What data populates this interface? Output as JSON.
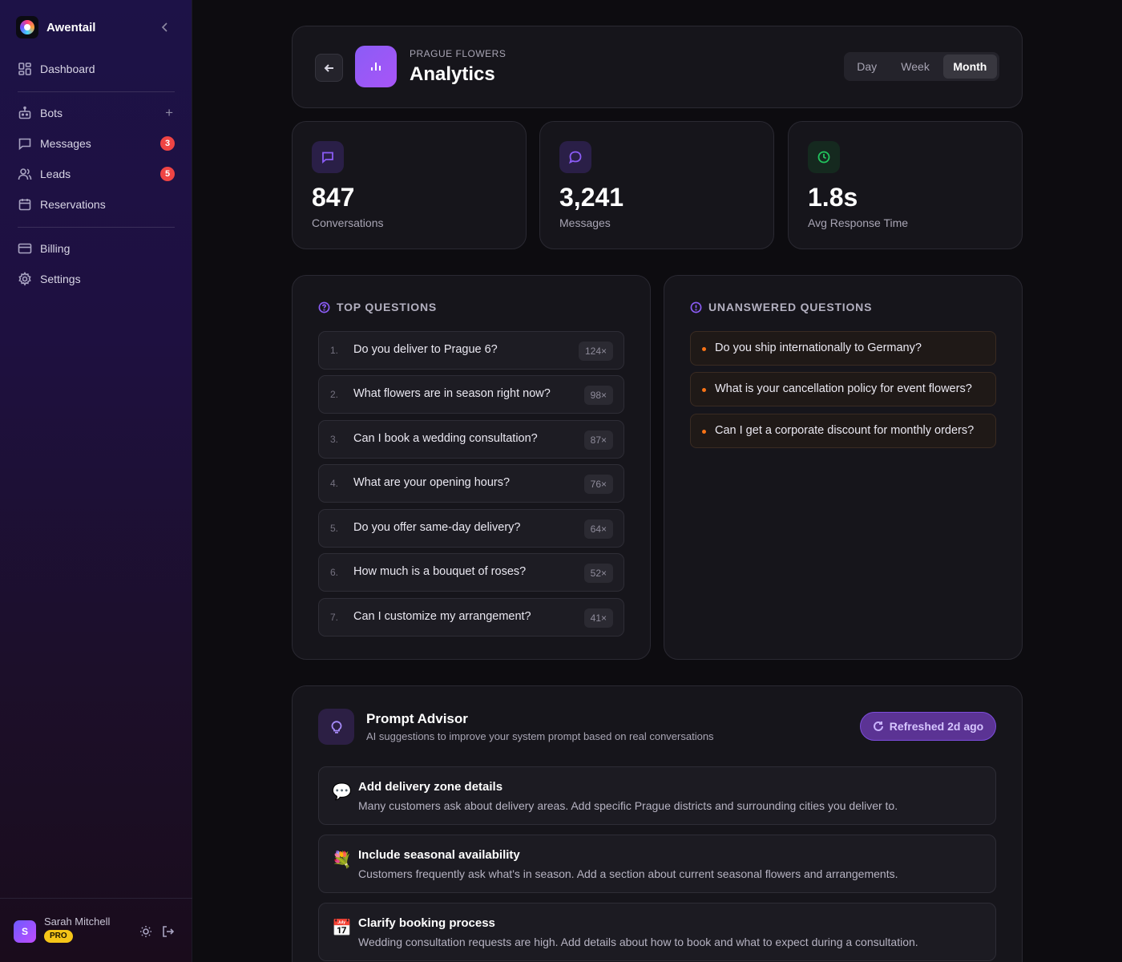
{
  "sidebar": {
    "brand": "Awentail",
    "items": [
      {
        "label": "Dashboard"
      },
      {
        "label": "Bots"
      },
      {
        "label": "Messages",
        "badge": "3"
      },
      {
        "label": "Leads",
        "badge": "5"
      },
      {
        "label": "Reservations"
      },
      {
        "label": "Billing"
      },
      {
        "label": "Settings"
      }
    ],
    "user": {
      "initial": "S",
      "name": "Sarah Mitchell",
      "plan": "PRO"
    }
  },
  "header": {
    "kicker": "PRAGUE FLOWERS",
    "title": "Analytics",
    "periods": [
      "Day",
      "Week",
      "Month"
    ],
    "active_period": "Month"
  },
  "stats": [
    {
      "value": "847",
      "label": "Conversations",
      "icon": "chat-square-icon",
      "color": "#8b5cf6"
    },
    {
      "value": "3,241",
      "label": "Messages",
      "icon": "chat-bubble-icon",
      "color": "#8b5cf6"
    },
    {
      "value": "1.8s",
      "label": "Avg Response Time",
      "icon": "clock-icon",
      "color": "#22c55e"
    }
  ],
  "top_questions": {
    "title": "TOP QUESTIONS",
    "items": [
      {
        "num": "1.",
        "text": "Do you deliver to Prague 6?",
        "count": "124×"
      },
      {
        "num": "2.",
        "text": "What flowers are in season right now?",
        "count": "98×"
      },
      {
        "num": "3.",
        "text": "Can I book a wedding consultation?",
        "count": "87×"
      },
      {
        "num": "4.",
        "text": "What are your opening hours?",
        "count": "76×"
      },
      {
        "num": "5.",
        "text": "Do you offer same-day delivery?",
        "count": "64×"
      },
      {
        "num": "6.",
        "text": "How much is a bouquet of roses?",
        "count": "52×"
      },
      {
        "num": "7.",
        "text": "Can I customize my arrangement?",
        "count": "41×"
      }
    ]
  },
  "unanswered": {
    "title": "UNANSWERED QUESTIONS",
    "items": [
      {
        "text": "Do you ship internationally to Germany?"
      },
      {
        "text": "What is your cancellation policy for event flowers?"
      },
      {
        "text": "Can I get a corporate discount for monthly orders?"
      }
    ]
  },
  "advisor": {
    "title": "Prompt Advisor",
    "subtitle": "AI suggestions to improve your system prompt based on real conversations",
    "refresh_label": "Refreshed 2d ago",
    "suggestions": [
      {
        "icon": "💬",
        "title": "Add delivery zone details",
        "text": "Many customers ask about delivery areas. Add specific Prague districts and surrounding cities you deliver to."
      },
      {
        "icon": "💐",
        "title": "Include seasonal availability",
        "text": "Customers frequently ask what's in season. Add a section about current seasonal flowers and arrangements."
      },
      {
        "icon": "📅",
        "title": "Clarify booking process",
        "text": "Wedding consultation requests are high. Add details about how to book and what to expect during a consultation."
      }
    ]
  }
}
